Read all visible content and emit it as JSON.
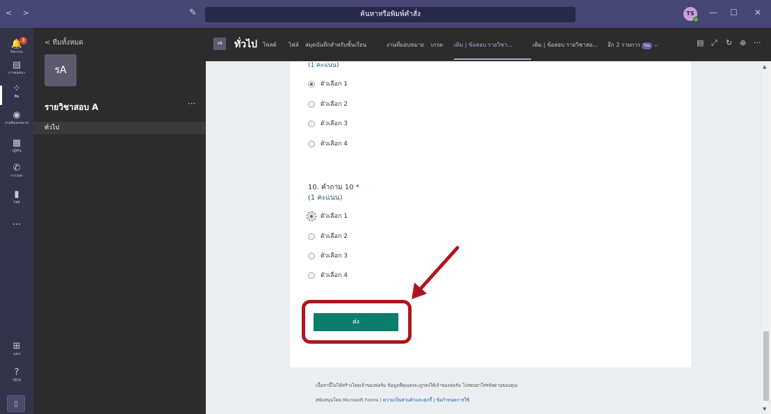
{
  "titlebar": {
    "nav": "< >",
    "compose_icon": "✎",
    "search_placeholder": "ค้นหาหรือพิมพ์คำสั่ง",
    "avatar": "TS",
    "minimize": "—",
    "maximize": "☐",
    "close": "✕"
  },
  "rail": {
    "items": [
      {
        "label": "กิจกรรม",
        "icon": "bell-icon",
        "glyph": "🔔",
        "badge": "3"
      },
      {
        "label": "การสนทนา",
        "icon": "chat-icon",
        "glyph": "▤"
      },
      {
        "label": "ทีม",
        "icon": "teams-icon",
        "glyph": "⁘"
      },
      {
        "label": "งานที่มอบหมาย",
        "icon": "assignments-icon",
        "glyph": "◉"
      },
      {
        "label": "ปฏิทิน",
        "icon": "calendar-icon",
        "glyph": "▦"
      },
      {
        "label": "การโทร",
        "icon": "phone-icon",
        "glyph": "✆"
      },
      {
        "label": "ไฟล์",
        "icon": "files-icon",
        "glyph": "▮"
      },
      {
        "label": "",
        "icon": "more-icon",
        "glyph": "···"
      }
    ],
    "apps": {
      "label": "แอป",
      "glyph": "⊞"
    },
    "help": {
      "label": "วิธีใช้",
      "glyph": "?"
    },
    "device_glyph": "▯"
  },
  "teams_panel": {
    "back_label": "<  ทีมทั้งหมด",
    "team_avatar": "รA",
    "team_name": "รายวิชาสอบ A",
    "team_more": "···",
    "channel": "ทั่วไป"
  },
  "header": {
    "channel_avatar": "รA",
    "channel_title": "ทั่วไป",
    "tabs": [
      {
        "label": "โพสต์"
      },
      {
        "label": "ไฟล์"
      },
      {
        "label": "สมุดบันทึกสำหรับชั้นเรียน"
      },
      {
        "label": "งานที่มอบหมาย"
      },
      {
        "label": "เกรด"
      },
      {
        "label": "เดิม | ข้อสอบ รายวิชา..."
      },
      {
        "label": "เดิม | ข้อสอบ รายวิชาสอ..."
      },
      {
        "label": "อีก 2 รายการ"
      }
    ],
    "new_badge": "ใหม่"
  },
  "form": {
    "prev_points": "(1 คะแนน)",
    "prev_options": [
      "ตัวเลือก 1",
      "ตัวเลือก 2",
      "ตัวเลือก 3",
      "ตัวเลือก 4"
    ],
    "q10_title": "10. คำถาม 10",
    "q10_required": "*",
    "q10_points": "(1 คะแนน)",
    "q10_options": [
      "ตัวเลือก 1",
      "ตัวเลือก 2",
      "ตัวเลือก 3",
      "ตัวเลือก 4"
    ],
    "submit_label": "ส่ง",
    "footer_line1": "เนื้อหานี้ไม่ได้สร้างโดยเจ้าของฟอร์ม ข้อมูลที่คุณส่งจะถูกส่งให้เจ้าของฟอร์ม โปรดอย่าใส่รหัสผ่านของคุณ",
    "footer_powered": "สนับสนุนโดย Microsoft Forms |",
    "footer_privacy": "ความเป็นส่วนตัวและคุกกี้",
    "footer_sep": "|",
    "footer_terms": "ข้อกำหนดการใช้"
  },
  "colors": {
    "titlebar": "#464775",
    "rail": "#33344a",
    "submit": "#0c7c6b",
    "highlight": "#b0151d"
  }
}
